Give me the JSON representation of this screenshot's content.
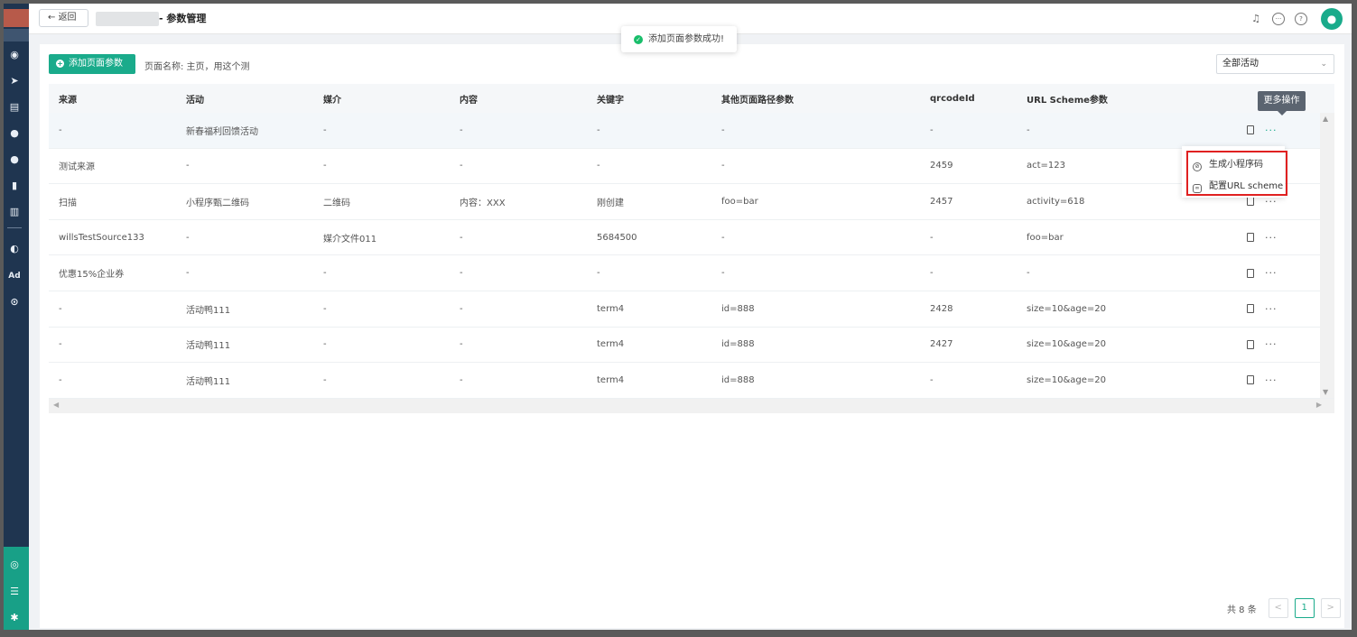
{
  "header": {
    "back_label": "返回",
    "title": "- 参数管理",
    "avatar_initial": "●"
  },
  "toolbar": {
    "add_button_label": "添加页面参数",
    "page_name_label": "页面名称: 主页，用这个测",
    "activity_filter_value": "全部活动"
  },
  "toast": {
    "message": "添加页面参数成功!"
  },
  "tooltip": {
    "text": "更多操作"
  },
  "dropdown": {
    "items": [
      {
        "label": "生成小程序码",
        "icon": "qrcode-icon"
      },
      {
        "label": "配置URL scheme",
        "icon": "link-icon"
      }
    ]
  },
  "table": {
    "columns": [
      "来源",
      "活动",
      "媒介",
      "内容",
      "关键字",
      "其他页面路径参数",
      "qrcodeId",
      "URL Scheme参数"
    ],
    "rows": [
      [
        "-",
        "新春福利回馈活动",
        "-",
        "-",
        "-",
        "-",
        "-",
        "-"
      ],
      [
        "测试来源",
        "-",
        "-",
        "-",
        "-",
        "-",
        "2459",
        "act=123"
      ],
      [
        "扫描",
        "小程序甄二维码",
        "二维码",
        "内容：XXX",
        "刚创建",
        "foo=bar",
        "2457",
        "activity=618"
      ],
      [
        "willsTestSource133",
        "-",
        "媒介文件011",
        "-",
        "5684500",
        "-",
        "-",
        "foo=bar"
      ],
      [
        "优惠15%企业券",
        "-",
        "-",
        "-",
        "-",
        "-",
        "-",
        "-"
      ],
      [
        "-",
        "活动鸭111",
        "-",
        "-",
        "term4",
        "id=888",
        "2428",
        "size=10&age=20"
      ],
      [
        "-",
        "活动鸭111",
        "-",
        "-",
        "term4",
        "id=888",
        "2427",
        "size=10&age=20"
      ],
      [
        "-",
        "活动鸭111",
        "-",
        "-",
        "term4",
        "id=888",
        "-",
        "size=10&age=20"
      ]
    ]
  },
  "pagination": {
    "total_label": "共 8 条",
    "current_page": "1",
    "prev": "<",
    "next": ">"
  },
  "colors": {
    "accent": "#1aab8b",
    "nav_bg": "#1f3550",
    "highlight_border": "#e02020",
    "toast_success": "#19be6b"
  }
}
